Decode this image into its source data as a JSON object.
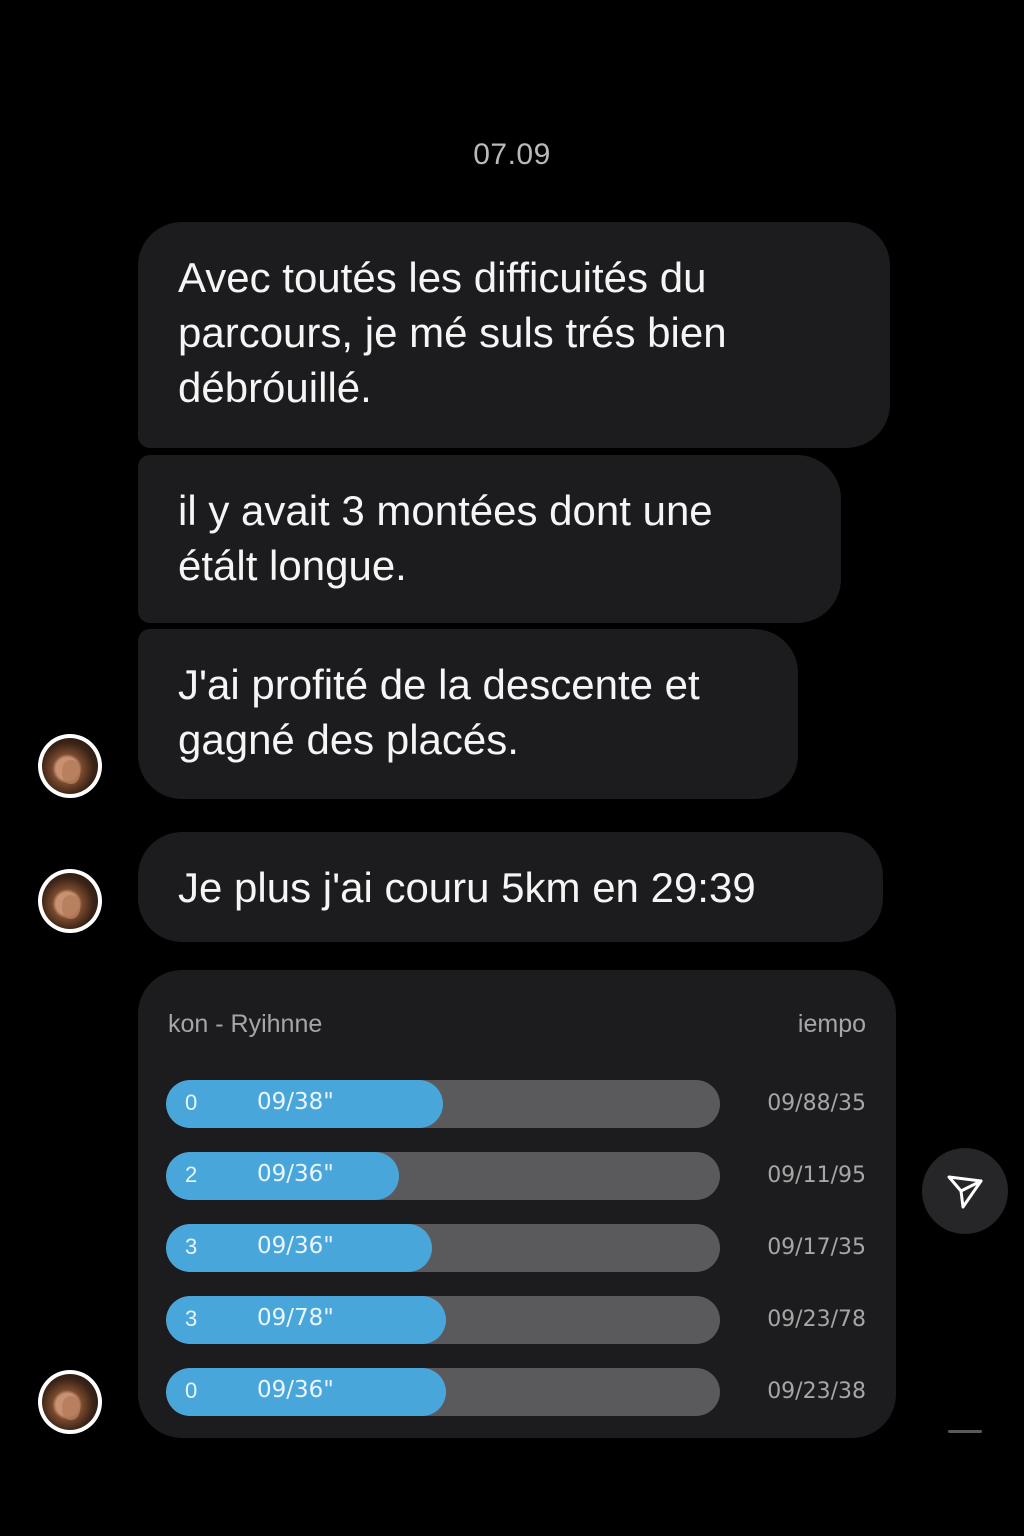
{
  "conversation": {
    "date": "07.09",
    "messages": [
      "Avec toutés les difficuités du parcours, je mé suls trés bien débróuillé.",
      "il y avait 3 montées dont une étált longue.",
      "J'ai profité de la descente et gagné des placés.",
      "Je plus j'ai couru 5km en 29:39"
    ]
  },
  "card": {
    "header_left": "kon - Ryihnne",
    "header_right": "iempo",
    "rows": [
      {
        "num": "0",
        "value": "09/38\"",
        "right": "09/88/35",
        "progress": 0.5
      },
      {
        "num": "2",
        "value": "09/36\"",
        "right": "09/11/95",
        "progress": 0.42
      },
      {
        "num": "3",
        "value": "09/36\"",
        "right": "09/17/35",
        "progress": 0.48
      },
      {
        "num": "3",
        "value": "09/78\"",
        "right": "09/23/78",
        "progress": 0.505
      },
      {
        "num": "0",
        "value": "09/36\"",
        "right": "09/23/38",
        "progress": 0.505
      }
    ]
  },
  "colors": {
    "bubble": "#1c1c1e",
    "accent_bar": "#49a6db",
    "track": "#5a5a5c"
  },
  "icons": {
    "send": "send-icon",
    "avatar": "avatar"
  }
}
